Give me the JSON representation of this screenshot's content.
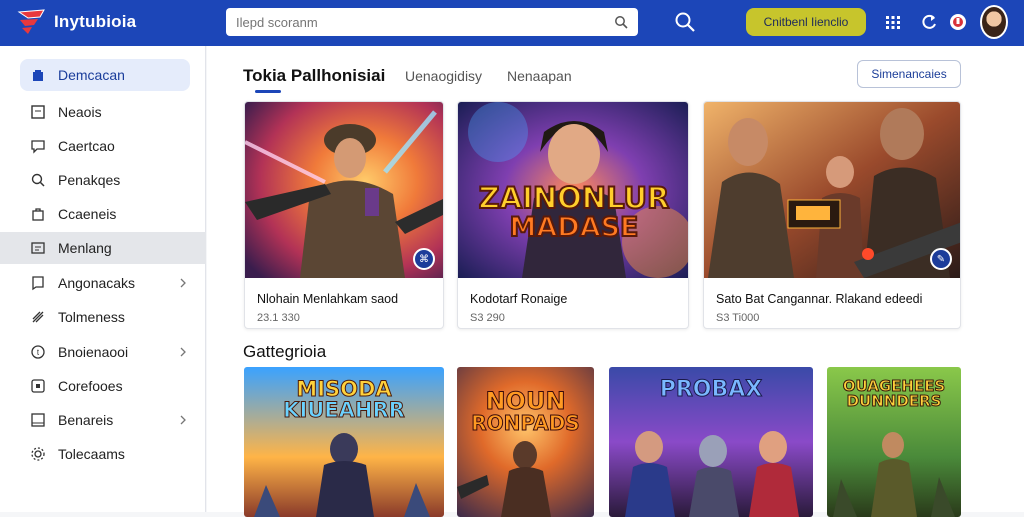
{
  "header": {
    "brand": "Inytubioia",
    "search_placeholder": "Ilepd scoranm",
    "cta_label": "Cnitbenl Iienclio",
    "icons": [
      "search-icon",
      "grid-icon",
      "refresh-icon",
      "bell-icon",
      "user-avatar"
    ]
  },
  "sidebar": {
    "items": [
      {
        "label": "Demcacan",
        "icon": "store-icon",
        "state": "active"
      },
      {
        "label": "Neaois",
        "icon": "box-icon"
      },
      {
        "label": "Caertcao",
        "icon": "chat-icon"
      },
      {
        "label": "Penakqes",
        "icon": "search-icon"
      },
      {
        "label": "Ccaeneis",
        "icon": "bag-icon"
      },
      {
        "label": "Menlang",
        "icon": "card-icon",
        "state": "highlight"
      },
      {
        "label": "Angonacaks",
        "icon": "bookmark-icon",
        "chevron": true
      },
      {
        "label": "Tolmeness",
        "icon": "tag-icon"
      },
      {
        "label": "Bnoienaooi",
        "icon": "coin-icon",
        "chevron": true
      },
      {
        "label": "Corefooes",
        "icon": "frame-icon"
      },
      {
        "label": "Benareis",
        "icon": "flag-icon",
        "chevron": true
      },
      {
        "label": "Tolecaams",
        "icon": "gear-icon"
      }
    ]
  },
  "main": {
    "tab_title": "Tokia Pallhonisiai",
    "tabs": [
      "Uenaogidisy",
      "Nenaapan"
    ],
    "see_all": "Simenancaies",
    "cards": [
      {
        "title": "Nlohain Menlahkam saod",
        "price": "23.1 330"
      },
      {
        "title": "Kodotarf Ronaige",
        "price": "S3 290",
        "art_text": [
          "ZAINONLUR",
          "MADASE"
        ]
      },
      {
        "title": "Sato Bat Cangannar. Rlakand edeedi",
        "price": "S3 Ti000"
      }
    ],
    "section_title": "Gattegrioia",
    "categories": [
      {
        "title": [
          "MISODA",
          "KIUEAHRR"
        ]
      },
      {
        "title": [
          "NOUN",
          "RONPADS"
        ]
      },
      {
        "title": [
          "PROBAX"
        ]
      },
      {
        "title": [
          "OUAGEHEES",
          "DUNNDERS"
        ]
      }
    ]
  }
}
